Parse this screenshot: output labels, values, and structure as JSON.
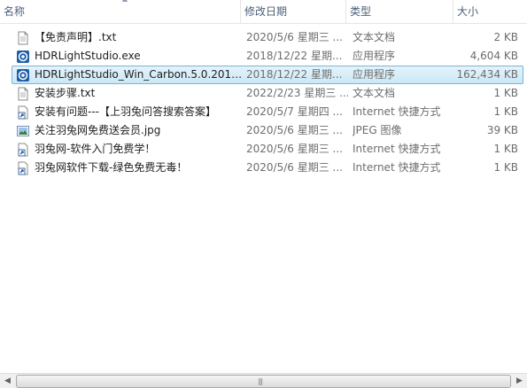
{
  "columns": {
    "name": "名称",
    "date": "修改日期",
    "type": "类型",
    "size": "大小"
  },
  "files": [
    {
      "name": "【免责声明】.txt",
      "date": "2020/5/6 星期三 ...",
      "type": "文本文档",
      "size": "2 KB",
      "icon": "text-file-icon"
    },
    {
      "name": "HDRLightStudio.exe",
      "date": "2018/12/22 星期...",
      "type": "应用程序",
      "size": "4,604 KB",
      "icon": "app-icon"
    },
    {
      "name": "HDRLightStudio_Win_Carbon.5.0.2018...",
      "date": "2018/12/22 星期...",
      "type": "应用程序",
      "size": "162,434 KB",
      "icon": "app-icon"
    },
    {
      "name": "安装步骤.txt",
      "date": "2022/2/23 星期三 ...",
      "type": "文本文档",
      "size": "1 KB",
      "icon": "text-file-icon"
    },
    {
      "name": "安装有问题---【上羽兔问答搜索答案】",
      "date": "2020/5/7 星期四 ...",
      "type": "Internet 快捷方式",
      "size": "1 KB",
      "icon": "shortcut-icon"
    },
    {
      "name": "关注羽兔网免费送会员.jpg",
      "date": "2020/5/6 星期三 ...",
      "type": "JPEG 图像",
      "size": "39 KB",
      "icon": "image-icon"
    },
    {
      "name": "羽兔网-软件入门免费学！",
      "date": "2020/5/6 星期三 ...",
      "type": "Internet 快捷方式",
      "size": "1 KB",
      "icon": "shortcut-icon"
    },
    {
      "name": "羽兔网软件下载-绿色免费无毒！",
      "date": "2020/5/6 星期三 ...",
      "type": "Internet 快捷方式",
      "size": "1 KB",
      "icon": "shortcut-icon"
    }
  ],
  "selected_index": 2,
  "scrollbar": {
    "left_arrow": "◀",
    "right_arrow": "▶",
    "grip": "|||"
  },
  "sort_indicator": "▲"
}
